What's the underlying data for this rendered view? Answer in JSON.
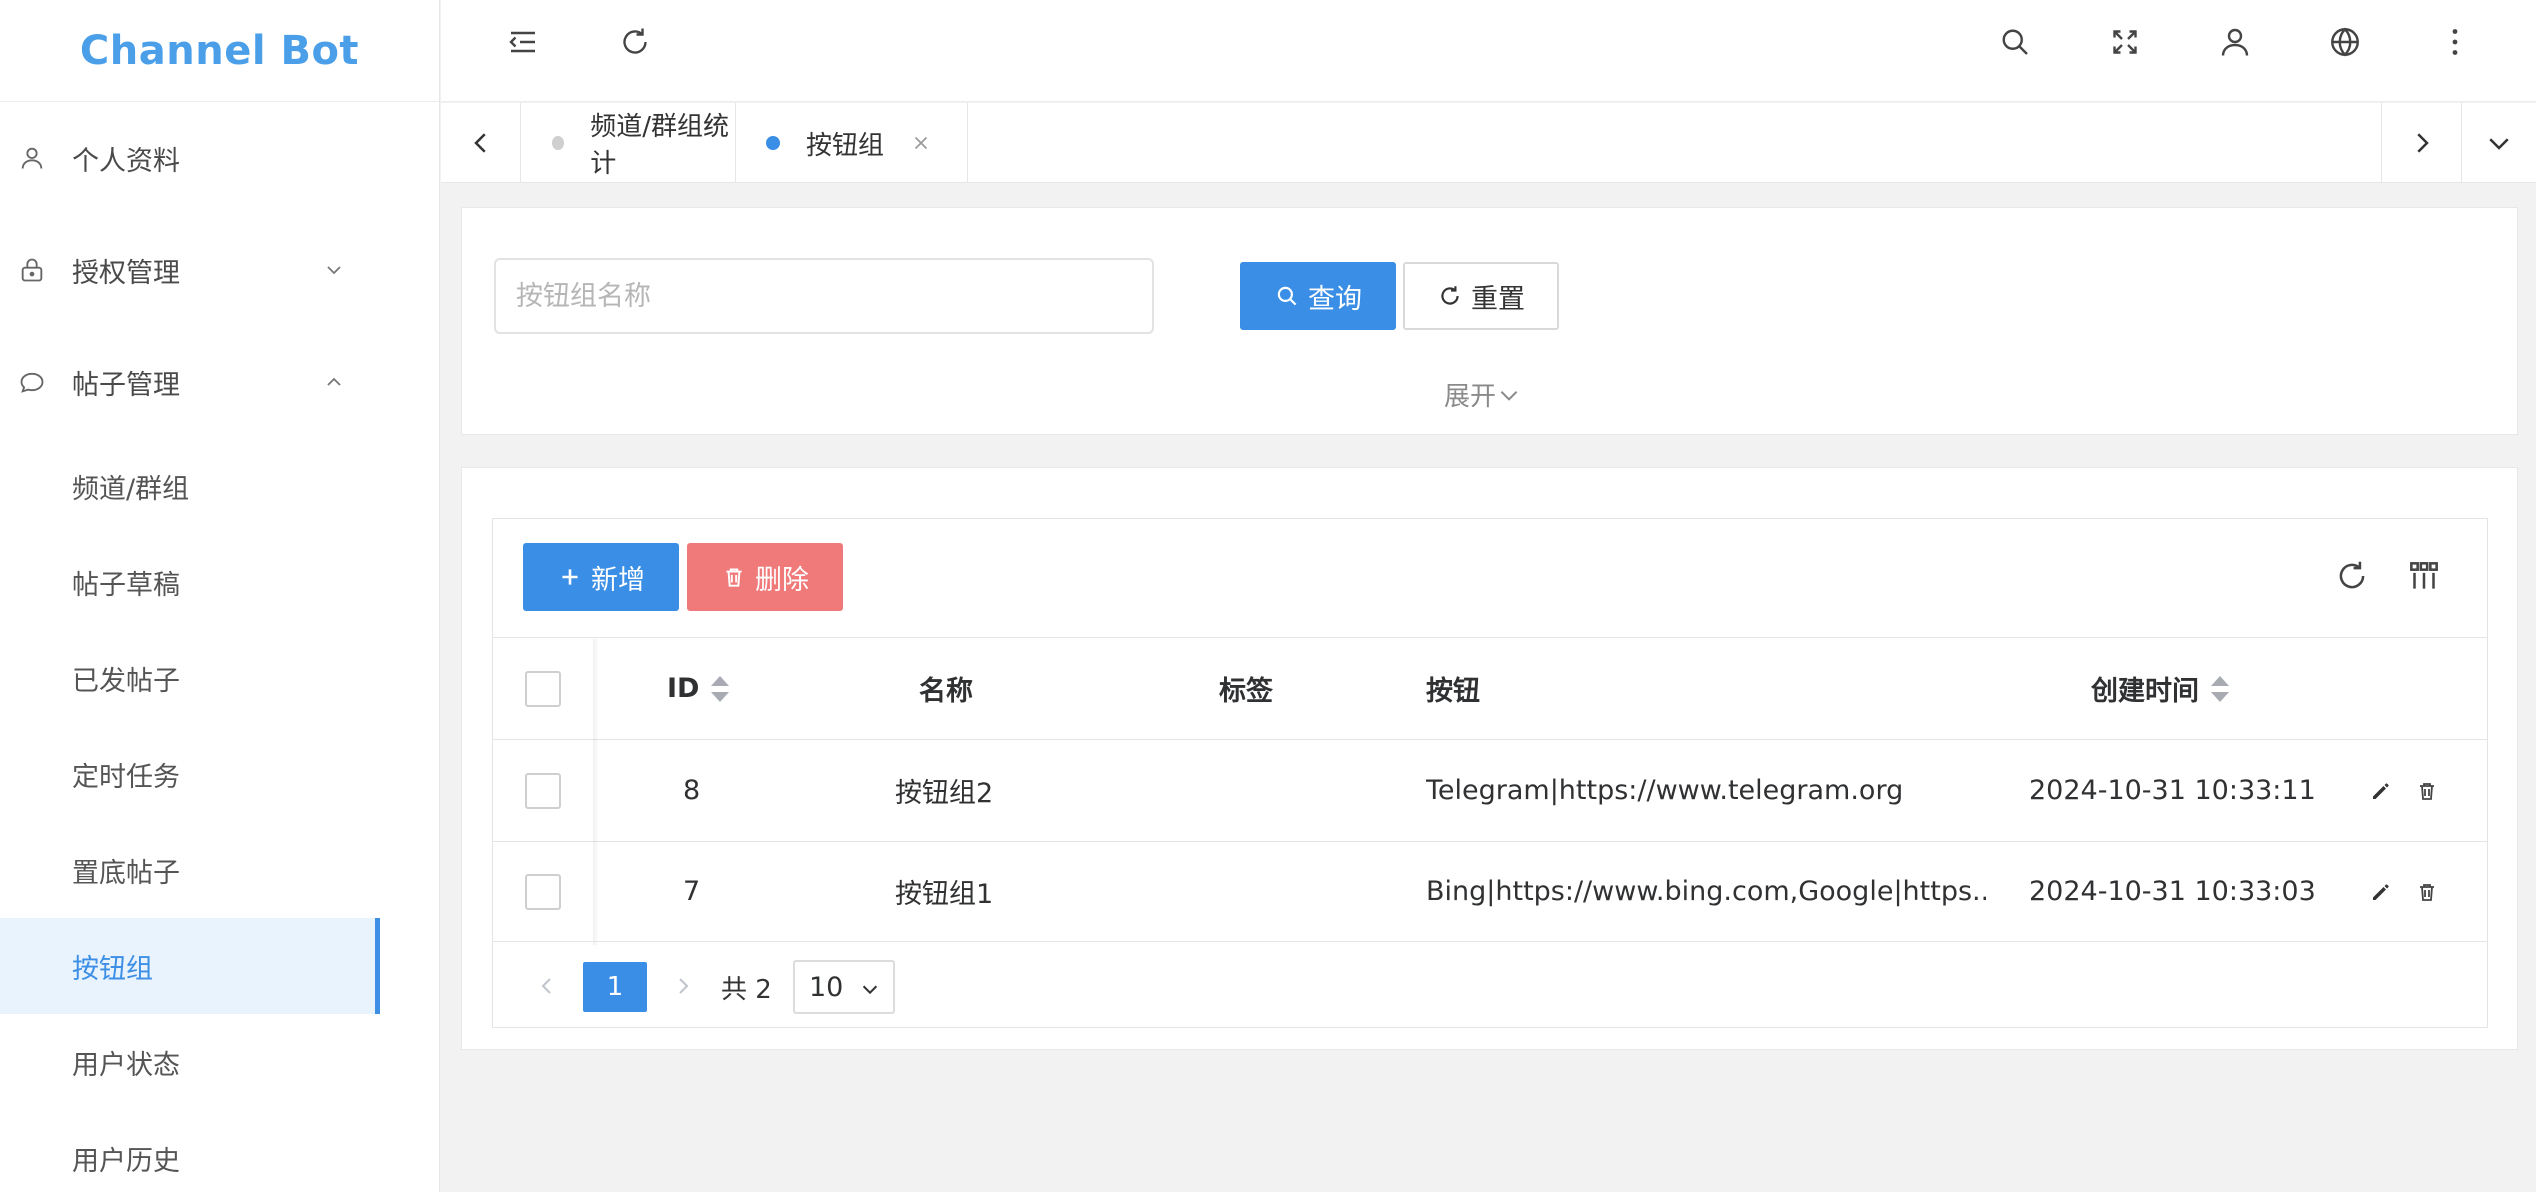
{
  "app": {
    "title": "Channel Bot"
  },
  "sidebar": {
    "items": [
      {
        "label": "个人资料",
        "icon": "user-icon"
      },
      {
        "label": "授权管理",
        "icon": "lock-icon",
        "expanded": false
      },
      {
        "label": "帖子管理",
        "icon": "chat-icon",
        "expanded": true
      }
    ],
    "sub_items": [
      {
        "label": "频道/群组"
      },
      {
        "label": "帖子草稿"
      },
      {
        "label": "已发帖子"
      },
      {
        "label": "定时任务"
      },
      {
        "label": "置底帖子"
      },
      {
        "label": "按钮组",
        "active": true
      },
      {
        "label": "用户状态"
      },
      {
        "label": "用户历史"
      }
    ]
  },
  "header": {
    "icons": [
      "menu-fold-icon",
      "refresh-icon",
      "search-icon",
      "fullscreen-icon",
      "user-icon",
      "globe-icon",
      "more-vertical-icon"
    ]
  },
  "tabs": [
    {
      "label": "频道/群组统计",
      "active": false
    },
    {
      "label": "按钮组",
      "active": true
    }
  ],
  "search": {
    "placeholder": "按钮组名称",
    "value": "",
    "query_label": "查询",
    "reset_label": "重置",
    "expand_label": "展开"
  },
  "toolbar": {
    "add_label": "新增",
    "delete_label": "删除"
  },
  "table": {
    "columns": [
      "ID",
      "名称",
      "标签",
      "按钮",
      "创建时间"
    ],
    "rows": [
      {
        "id": "8",
        "name": "按钮组2",
        "tag": "",
        "buttons": "Telegram|https://www.telegram.org",
        "created": "2024-10-31 10:33:11"
      },
      {
        "id": "7",
        "name": "按钮组1",
        "tag": "",
        "buttons": "Bing|https://www.bing.com,Google|https...",
        "created": "2024-10-31 10:33:03"
      }
    ]
  },
  "pagination": {
    "current_page": "1",
    "total_label": "共 2",
    "page_size": "10"
  },
  "colors": {
    "primary": "#3a8ee6",
    "danger": "#f07a7a",
    "brand": "#4a9fe8",
    "active_bg": "#e8f3fd"
  }
}
